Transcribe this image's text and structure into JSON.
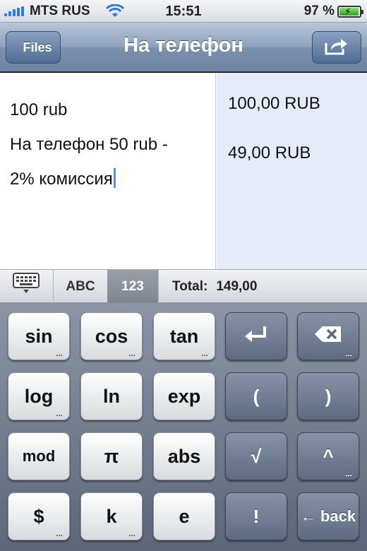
{
  "status_bar": {
    "carrier": "MTS RUS",
    "time": "15:51",
    "battery_percent": "97 %",
    "battery_level": 0.97,
    "signal_icon": "signal-bars-icon",
    "wifi_icon": "wifi-icon",
    "battery_icon": "battery-charging-icon"
  },
  "nav": {
    "back_label": "Files",
    "title": "На телефон",
    "share_icon": "share-icon"
  },
  "editor": {
    "lines": [
      "100 rub",
      "На телефон 50 rub -",
      "2% комиссия"
    ]
  },
  "results": {
    "values": [
      "100,00 RUB",
      "49,00 RUB"
    ]
  },
  "toolbar": {
    "keyboard_icon": "keyboard-icon",
    "abc_label": "ABC",
    "num_label": "123",
    "num_selected": true,
    "total_label": "Total:",
    "total_value": "149,00"
  },
  "keys": {
    "row1": [
      "sin",
      "cos",
      "tan",
      "↵",
      "⌫"
    ],
    "row2": [
      "log",
      "ln",
      "exp",
      "(",
      ")"
    ],
    "row3": [
      "mod",
      "π",
      "abs",
      "√",
      "^"
    ],
    "row4": [
      "$",
      "k",
      "e",
      "!",
      "← back"
    ],
    "more_marker": "..."
  },
  "colors": {
    "nav_bar": "#7b90ac",
    "result_panel": "#e6ecf7",
    "cursor": "#5a8ee8",
    "selected_tab": "#8a9099"
  }
}
